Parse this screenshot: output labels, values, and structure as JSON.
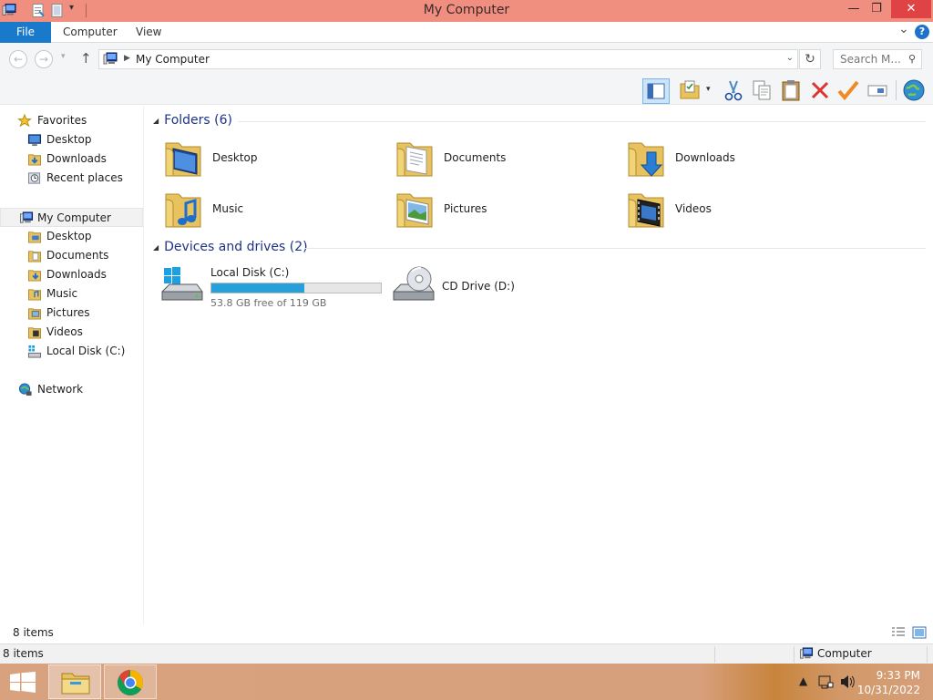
{
  "window": {
    "title": "My Computer",
    "minimize_glyph": "—",
    "restore_glyph": "❐",
    "close_glyph": "✕"
  },
  "ribbon": {
    "tabs": [
      {
        "label": "File",
        "active": true
      },
      {
        "label": "Computer"
      },
      {
        "label": "View"
      }
    ],
    "help_glyph": "?",
    "expand_glyph": "⌄"
  },
  "address": {
    "crumb": "My Computer",
    "search_placeholder": "Search M...",
    "back_glyph": "←",
    "forward_glyph": "→",
    "up_glyph": "↑",
    "refresh_glyph": "↻"
  },
  "toolbar": {
    "icons": [
      "layout-pane-icon",
      "properties-folder-icon",
      "cut-icon",
      "copy-icon",
      "paste-icon",
      "delete-icon",
      "checkmark-icon",
      "rename-icon",
      "globe-icon"
    ]
  },
  "nav": {
    "favorites_label": "Favorites",
    "favorites": [
      {
        "label": "Desktop",
        "icon": "desktop-icon"
      },
      {
        "label": "Downloads",
        "icon": "downloads-folder-icon"
      },
      {
        "label": "Recent places",
        "icon": "recent-places-icon"
      }
    ],
    "computer_label": "My Computer",
    "computer_items": [
      {
        "label": "Desktop",
        "icon": "folder-icon"
      },
      {
        "label": "Documents",
        "icon": "folder-icon"
      },
      {
        "label": "Downloads",
        "icon": "folder-icon"
      },
      {
        "label": "Music",
        "icon": "folder-icon"
      },
      {
        "label": "Pictures",
        "icon": "folder-icon"
      },
      {
        "label": "Videos",
        "icon": "folder-icon"
      },
      {
        "label": "Local Disk (C:)",
        "icon": "drive-icon"
      }
    ],
    "network_label": "Network"
  },
  "content": {
    "folders_header": "Folders (6)",
    "folders": [
      {
        "label": "Desktop",
        "icon": "desktop-folder-icon"
      },
      {
        "label": "Documents",
        "icon": "documents-folder-icon"
      },
      {
        "label": "Downloads",
        "icon": "downloads-folder-icon"
      },
      {
        "label": "Music",
        "icon": "music-folder-icon"
      },
      {
        "label": "Pictures",
        "icon": "pictures-folder-icon"
      },
      {
        "label": "Videos",
        "icon": "videos-folder-icon"
      }
    ],
    "devices_header": "Devices and drives (2)",
    "local_disk": {
      "name": "Local Disk (C:)",
      "free_text": "53.8 GB free of 119 GB",
      "used_fraction": 0.548
    },
    "cd_drive": {
      "name": "CD Drive (D:)"
    }
  },
  "status": {
    "item_count": "8 items",
    "details_count": "8 items",
    "location": "Computer"
  },
  "taskbar": {
    "time": "9:33 PM",
    "date": "10/31/2022",
    "tray_up_glyph": "▲"
  },
  "colors": {
    "titlebar": "#f08e80",
    "accent": "#1979ca",
    "drive_fill": "#26a0da",
    "group_header": "#1e3287",
    "close_button": "#e04343"
  }
}
